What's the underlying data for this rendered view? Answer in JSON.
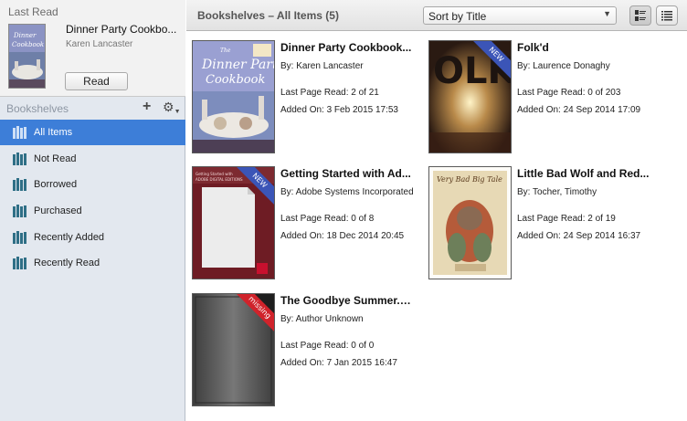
{
  "last_read": {
    "header": "Last Read",
    "title": "Dinner Party Cookbo...",
    "author": "Karen Lancaster",
    "read_button": "Read"
  },
  "bookshelves": {
    "header": "Bookshelves",
    "items": [
      {
        "label": "All Items",
        "selected": true
      },
      {
        "label": "Not Read"
      },
      {
        "label": "Borrowed"
      },
      {
        "label": "Purchased"
      },
      {
        "label": "Recently Added"
      },
      {
        "label": "Recently Read"
      }
    ]
  },
  "toolbar": {
    "title": "Bookshelves – All Items (5)",
    "sort_selected": "Sort by Title"
  },
  "books": [
    {
      "title": "Dinner Party Cookbook...",
      "author": "By: Karen Lancaster",
      "last_page_read": "Last Page Read: 2 of 21",
      "added_on": "Added On: 3 Feb 2015 17:53",
      "badge": "",
      "cover_text": "The Dinner Party Cookbook"
    },
    {
      "title": "Folk'd",
      "author": "By: Laurence Donaghy",
      "last_page_read": "Last Page Read: 0 of 203",
      "added_on": "Added On: 24 Sep 2014 17:09",
      "badge": "NEW",
      "cover_text": "OLK"
    },
    {
      "title": "Getting Started with Ad...",
      "author": "By: Adobe Systems Incorporated",
      "last_page_read": "Last Page Read: 0 of 8",
      "added_on": "Added On: 18 Dec 2014 20:45",
      "badge": "NEW",
      "cover_text": "ADOBE DIGITAL EDITIONS"
    },
    {
      "title": "Little Bad Wolf and Red...",
      "author": "By: Tocher, Timothy",
      "last_page_read": "Last Page Read: 2 of 19",
      "added_on": "Added On: 24 Sep 2014 16:37",
      "badge": "",
      "cover_text": "Very Bad Big Tale"
    },
    {
      "title": "The Goodbye Summer.pdf",
      "author": "By: Author Unknown",
      "last_page_read": "Last Page Read: 0 of 0",
      "added_on": "Added On: 7 Jan 2015 16:47",
      "badge": "missing",
      "cover_text": ""
    }
  ],
  "colors": {
    "selection": "#3d7ed8",
    "new_badge": "#3b55b7",
    "missing_badge": "#d0232b",
    "sidebar_bg": "#e3e8ef"
  }
}
